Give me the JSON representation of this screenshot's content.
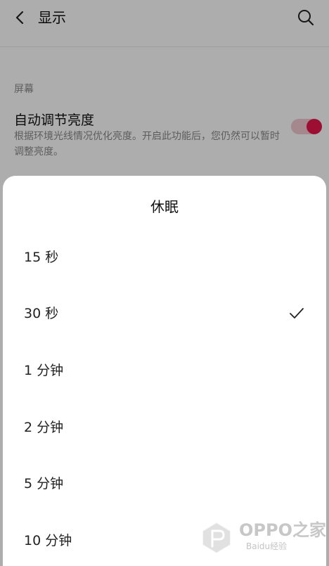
{
  "header": {
    "title": "显示",
    "back_icon": "chevron-left-icon",
    "search_icon": "search-icon"
  },
  "screen_section": {
    "label": "屏幕",
    "auto_brightness": {
      "title": "自动调节亮度",
      "description": "根据环境光线情况优化亮度。开启此功能后，您仍然可以暂时调整亮度。",
      "enabled": true
    }
  },
  "sleep_sheet": {
    "title": "休眠",
    "options": [
      {
        "label": "15 秒",
        "selected": false
      },
      {
        "label": "30 秒",
        "selected": true
      },
      {
        "label": "1 分钟",
        "selected": false
      },
      {
        "label": "2 分钟",
        "selected": false
      },
      {
        "label": "5 分钟",
        "selected": false
      },
      {
        "label": "10 分钟",
        "selected": false
      }
    ]
  },
  "watermark": {
    "text": "OPPO之家",
    "sub": "Baidu经验"
  },
  "colors": {
    "accent": "#e8174a",
    "toggle_track": "#f3c9d1",
    "check": "#222222"
  }
}
